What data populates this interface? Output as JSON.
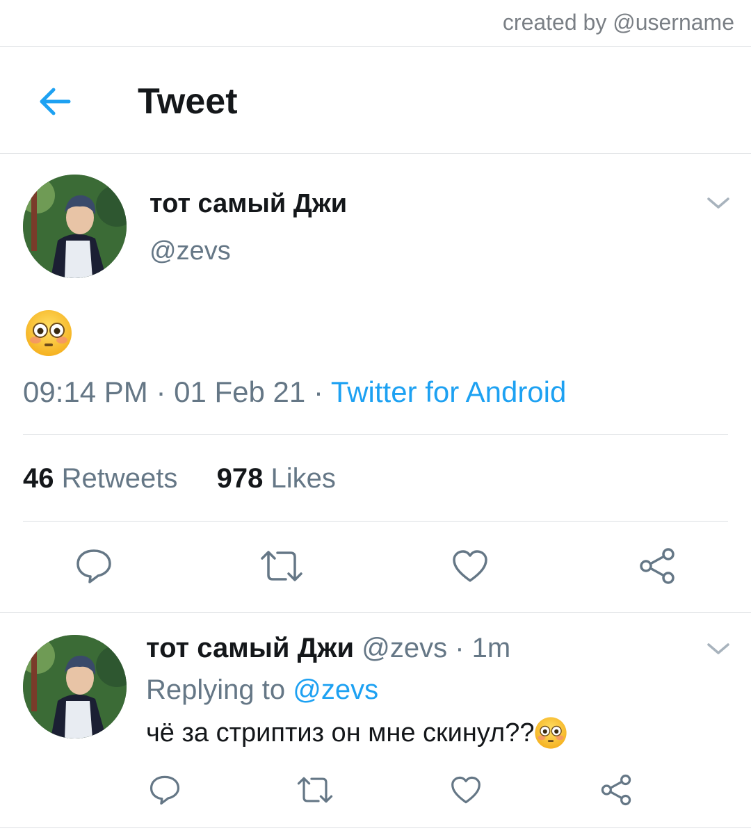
{
  "watermark": "created by @username",
  "header": {
    "title": "Tweet",
    "back_icon": "arrow-left-icon"
  },
  "tweet": {
    "display_name": "тот самый Джи",
    "handle": "@zevs",
    "content_emoji": "flushed-face",
    "time": "09:14 PM",
    "date": "01 Feb 21",
    "source": "Twitter for Android",
    "retweets_count": "46",
    "retweets_label": "Retweets",
    "likes_count": "978",
    "likes_label": "Likes"
  },
  "reply": {
    "display_name": "тот самый Джи",
    "handle": "@zevs",
    "time_ago": "1m",
    "replying_label": "Replying to",
    "replying_to": "@zevs",
    "text": "чё за стриптиз он мне скинул??"
  },
  "colors": {
    "accent": "#1da1f2",
    "muted": "#657786",
    "text": "#14171a",
    "divider": "#dcdfe2"
  }
}
